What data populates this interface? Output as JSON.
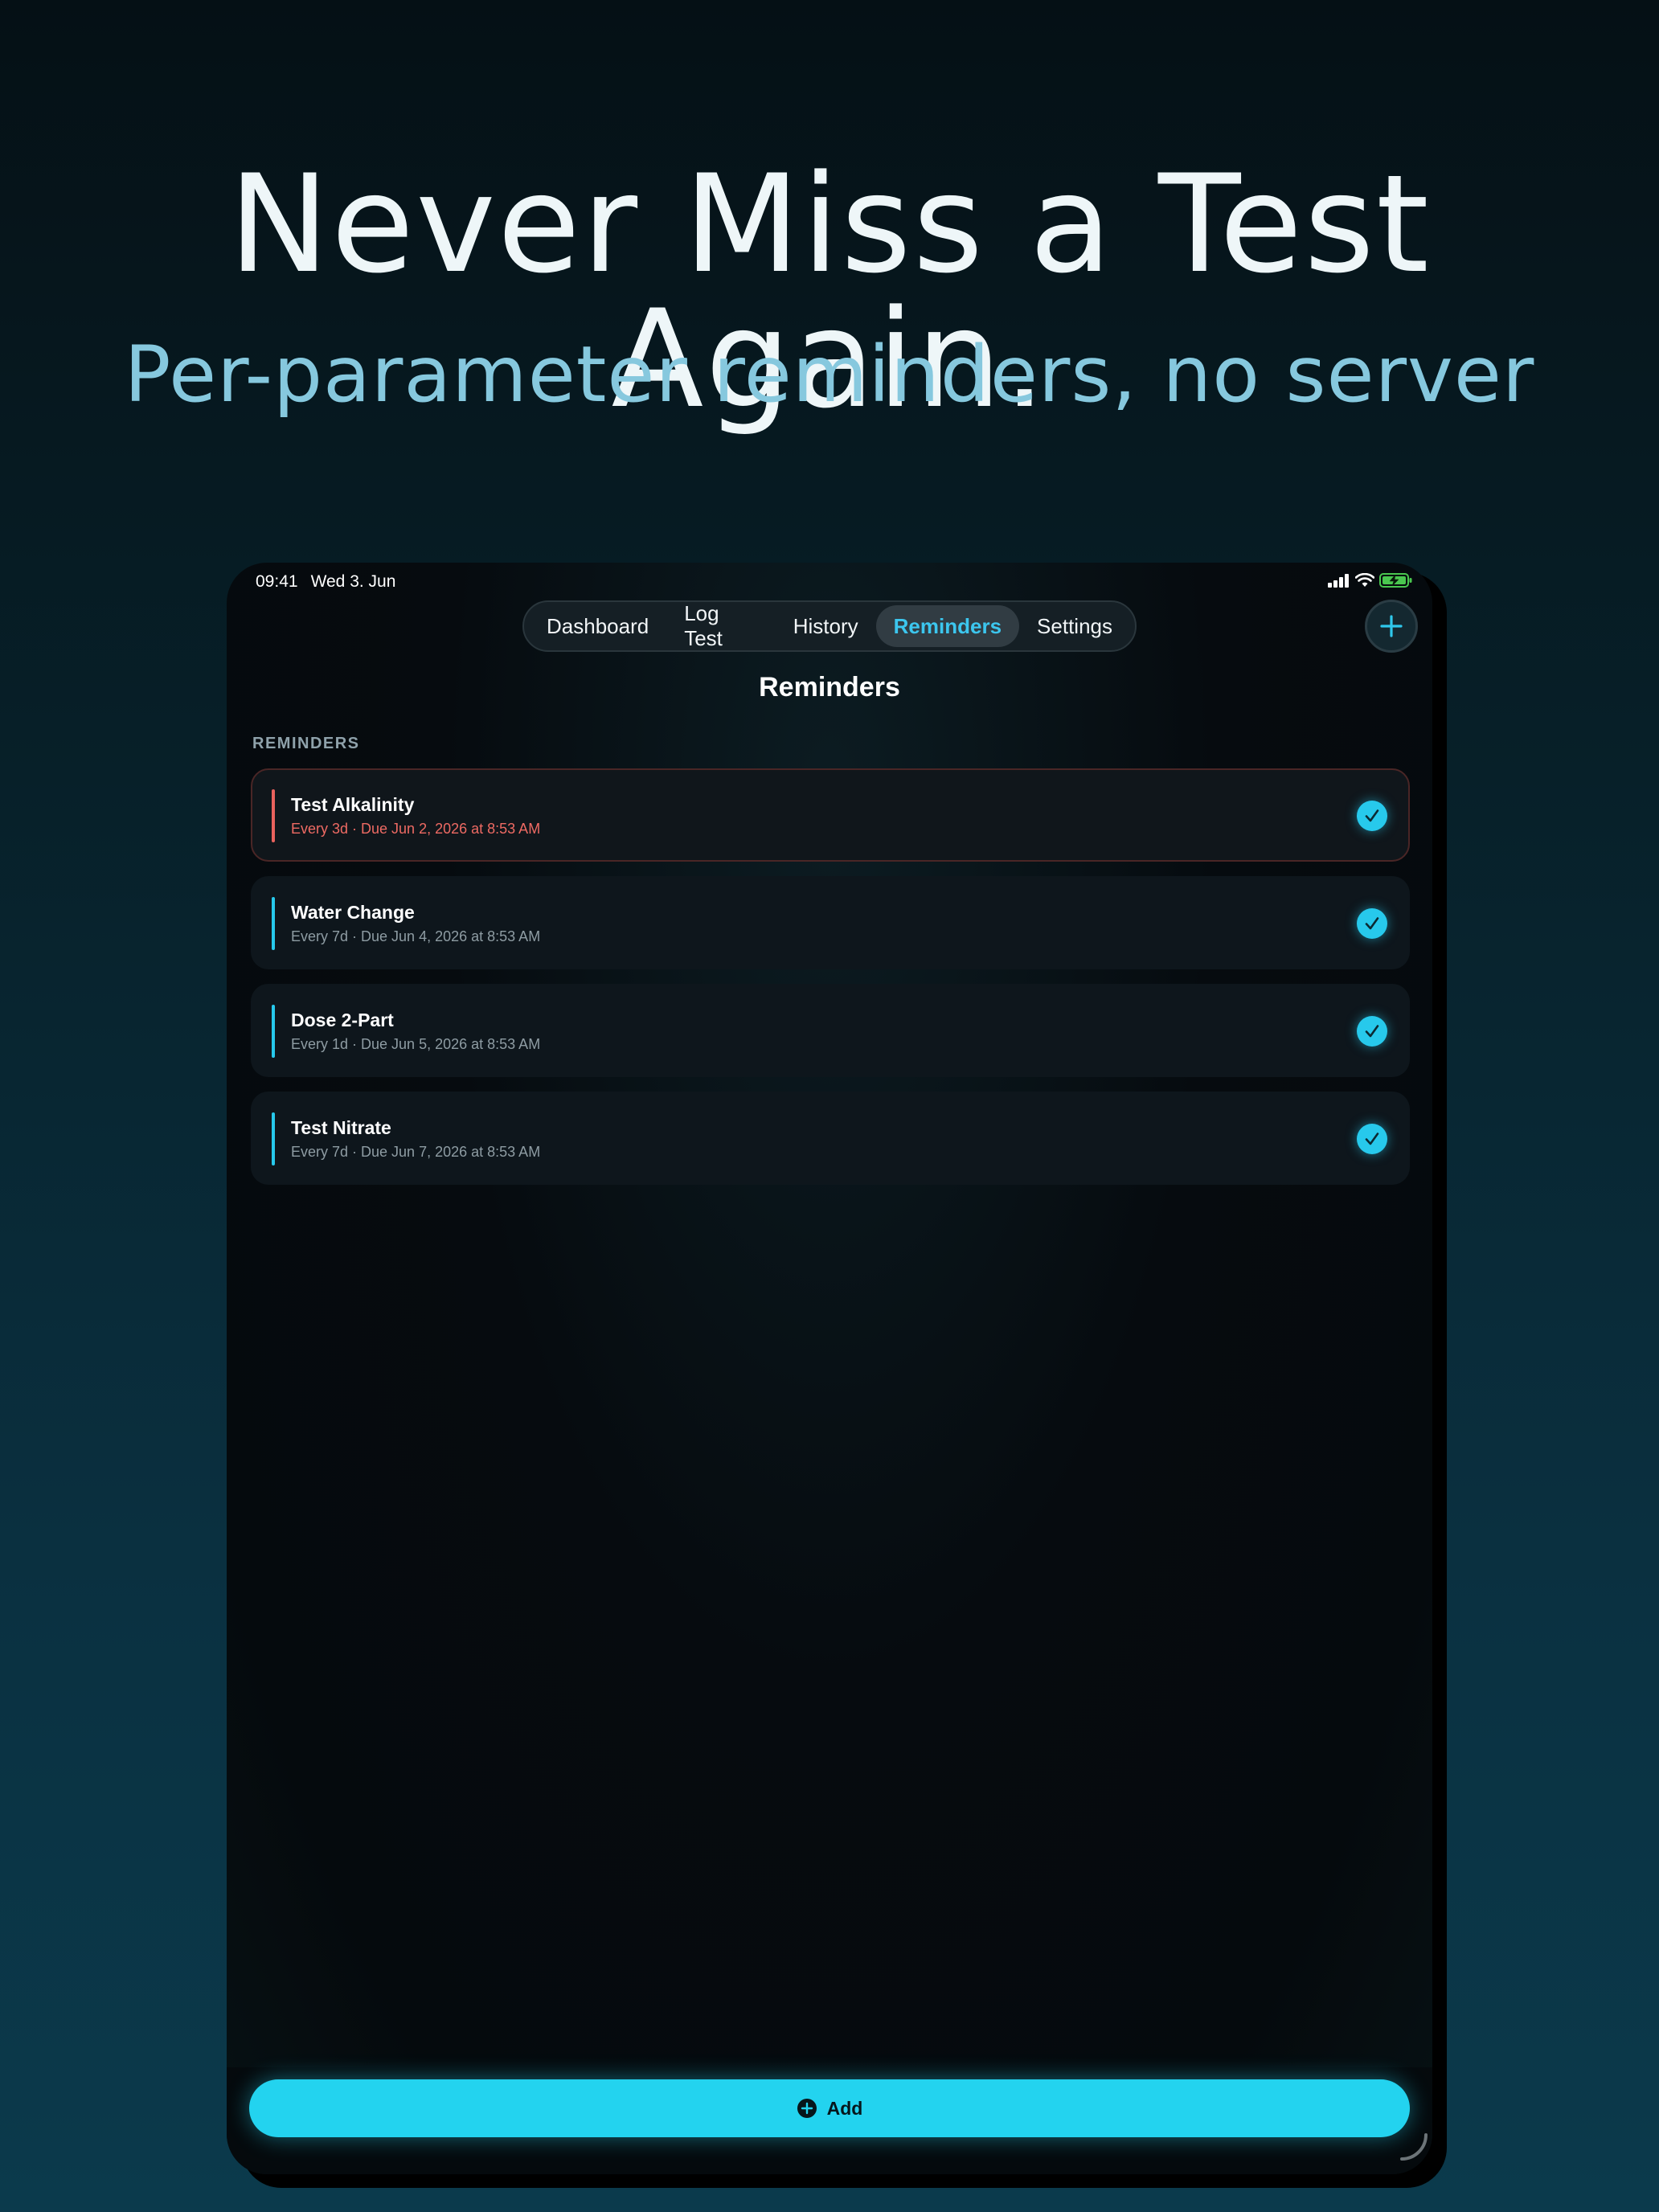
{
  "hero": {
    "title": "Never Miss a Test Again.",
    "subtitle": "Per-parameter reminders, no server"
  },
  "status_bar": {
    "time": "09:41",
    "date": "Wed 3. Jun",
    "icons": [
      "cellular-signal-icon",
      "wifi-icon",
      "battery-charging-icon"
    ]
  },
  "tabs": [
    {
      "label": "Dashboard",
      "active": false
    },
    {
      "label": "Log Test",
      "active": false
    },
    {
      "label": "History",
      "active": false
    },
    {
      "label": "Reminders",
      "active": true
    },
    {
      "label": "Settings",
      "active": false
    }
  ],
  "page": {
    "title": "Reminders",
    "section_label": "REMINDERS"
  },
  "reminders": [
    {
      "title": "Test Alkalinity",
      "subtitle": "Every 3d · Due Jun 2, 2026 at 8:53 AM",
      "status": "overdue"
    },
    {
      "title": "Water Change",
      "subtitle": "Every 7d · Due Jun 4, 2026 at 8:53 AM",
      "status": "upcoming"
    },
    {
      "title": "Dose 2-Part",
      "subtitle": "Every 1d · Due Jun 5, 2026 at 8:53 AM",
      "status": "upcoming"
    },
    {
      "title": "Test Nitrate",
      "subtitle": "Every 7d · Due Jun 7, 2026 at 8:53 AM",
      "status": "upcoming"
    }
  ],
  "add_button": {
    "label": "Add",
    "icon": "plus-circle-icon"
  },
  "colors": {
    "accent": "#23d3ef",
    "overdue": "#e9625d",
    "active_tab_text": "#3cc6ee",
    "hero_subtitle": "#86c8de"
  }
}
